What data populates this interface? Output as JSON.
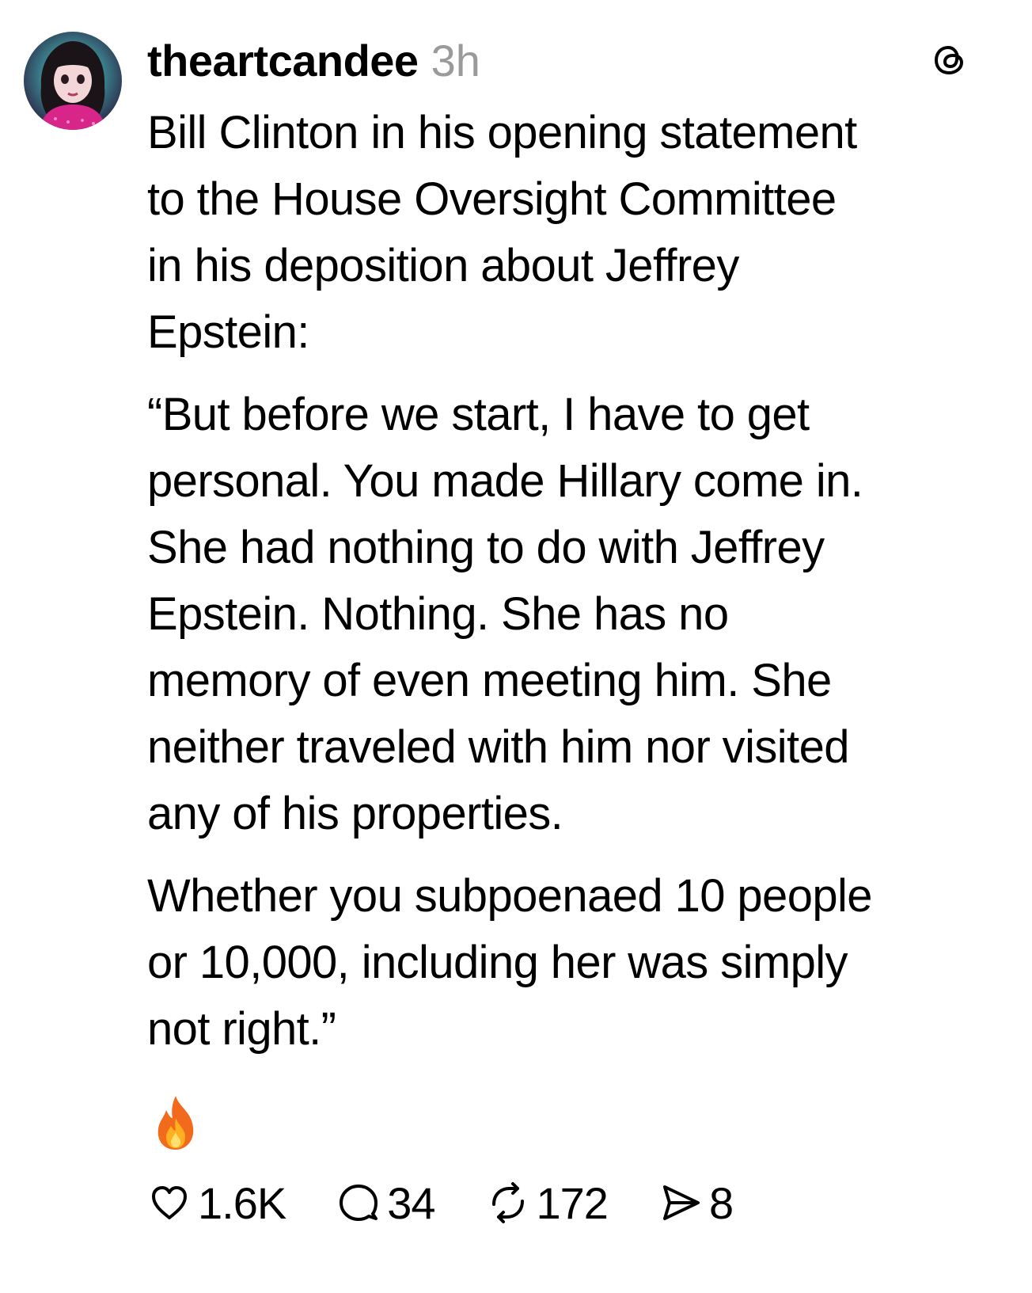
{
  "post": {
    "author": "theartcandee",
    "time": "3h",
    "body": [
      "Bill Clinton in his opening statement to the House Oversight Committee in his deposition about Jeffrey Epstein:",
      "“But before we start, I have to get personal. You made Hillary come in. She had nothing to do with Jeffrey Epstein. Nothing. She has no memory of even meeting him. She neither traveled with him nor visited any of his properties.",
      "Whether you subpoenaed 10 people or 10,000, including her was simply not right.”"
    ],
    "body_lines": [
      [
        "Bill Clinton in his opening statement",
        "to the House Oversight Committee",
        "in his deposition about Jeffrey",
        "Epstein:"
      ],
      [
        "“But before we start, I have to get",
        "personal. You made Hillary come in.",
        "She had nothing to do with Jeffrey",
        "Epstein. Nothing. She has no",
        "memory of even meeting him. She",
        "neither traveled with him nor visited",
        "any of his properties."
      ],
      [
        "Whether you subpoenaed 10 people",
        "or 10,000, including her was simply",
        "not right.”"
      ]
    ],
    "emoji": "fire-emoji",
    "icons": {
      "avatar": "avatar-portrait-icon",
      "app": "threads-logo-icon",
      "like": "heart-icon",
      "reply": "comment-bubble-icon",
      "repost": "repost-icon",
      "share": "send-icon"
    }
  },
  "actions": {
    "likes": "1.6K",
    "replies": "34",
    "reposts": "172",
    "shares": "8"
  },
  "colors": {
    "text": "#000000",
    "muted": "#9a9a9a",
    "background": "#ffffff"
  }
}
